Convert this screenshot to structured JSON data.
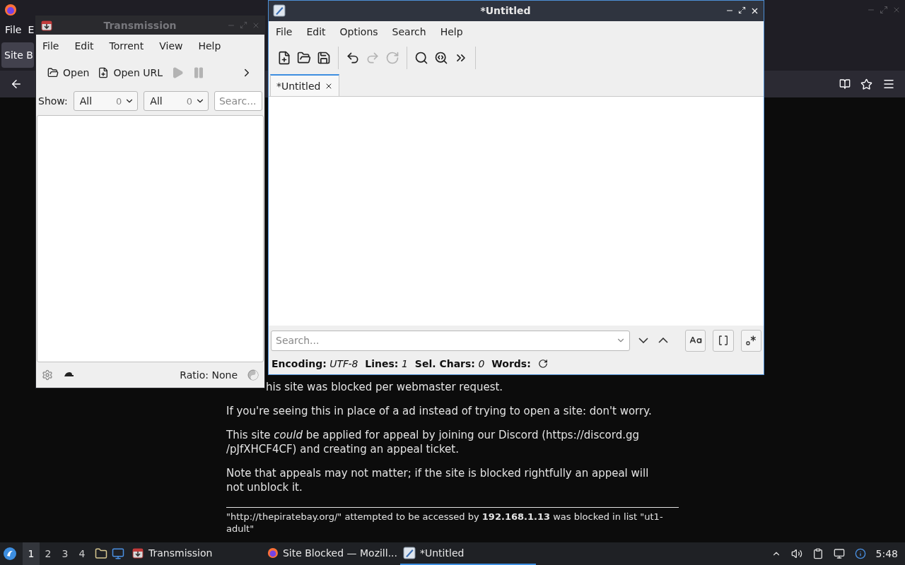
{
  "browser": {
    "menu": [
      "File",
      "E"
    ],
    "tab": "Site B",
    "paragraphs": [
      "his site was blocked per webmaster request.",
      "If you're seeing this in place of a ad instead of trying to open a site: don't worry.",
      "This site *could* be applied for appeal by joining our Discord (https://discord.gg /pJfXHCF4CF) and creating an appeal ticket.",
      "Note that appeals may not matter; if the site is blocked rightfully an appeal will not unblock it."
    ],
    "footer": "\"http://thepiratebay.org/\" attempted to be accessed by **192.168.1.13** was blocked in list \"ut1-adult\""
  },
  "transmission": {
    "title": "Transmission",
    "menu": [
      "File",
      "Edit",
      "Torrent",
      "View",
      "Help"
    ],
    "toolbar": [
      {
        "kind": "open",
        "label": "Open",
        "disabled": false
      },
      {
        "kind": "open-url",
        "label": "Open URL",
        "disabled": false
      },
      {
        "kind": "start",
        "disabled": true
      },
      {
        "kind": "pause",
        "disabled": true
      },
      {
        "kind": "more",
        "disabled": false
      }
    ],
    "show_label": "Show:",
    "filters": [
      {
        "value": "All",
        "count": "0"
      },
      {
        "value": "All",
        "count": "0"
      }
    ],
    "search": {
      "placeholder": "Searc..."
    },
    "ratio": "Ratio: None"
  },
  "editor": {
    "title": "*Untitled",
    "menu": [
      "File",
      "Edit",
      "Options",
      "Search",
      "Help"
    ],
    "toolbar": [
      {
        "kind": "new",
        "disabled": false
      },
      {
        "kind": "open",
        "disabled": false
      },
      {
        "kind": "save",
        "disabled": false
      },
      {
        "kind": "sep"
      },
      {
        "kind": "undo",
        "disabled": false
      },
      {
        "kind": "redo",
        "disabled": true
      },
      {
        "kind": "reload",
        "disabled": true
      },
      {
        "kind": "sep"
      },
      {
        "kind": "find",
        "disabled": false
      },
      {
        "kind": "replace",
        "disabled": false
      },
      {
        "kind": "more",
        "disabled": false
      },
      {
        "kind": "sep"
      }
    ],
    "tabs": [
      {
        "label": "*Untitled",
        "selected": true
      }
    ],
    "search": {
      "placeholder": "Search..."
    },
    "status": [
      {
        "label": "Encoding:",
        "value": "UTF-8"
      },
      {
        "label": "Lines:",
        "value": "1"
      },
      {
        "label": "Sel. Chars:",
        "value": "0"
      },
      {
        "label": "Words:"
      }
    ]
  },
  "taskbar": {
    "workspaces": [
      {
        "label": "1",
        "selected": true
      },
      {
        "label": "2",
        "selected": false
      },
      {
        "label": "3",
        "selected": false
      },
      {
        "label": "4",
        "selected": false
      }
    ],
    "tasks": [
      {
        "kind": "transmission",
        "label": "Transmission",
        "selected": false
      },
      {
        "kind": "browser",
        "label": "Site Blocked — Mozill...",
        "selected": false
      },
      {
        "kind": "editor",
        "label": "*Untitled",
        "selected": true
      }
    ],
    "clock": "5:48"
  }
}
